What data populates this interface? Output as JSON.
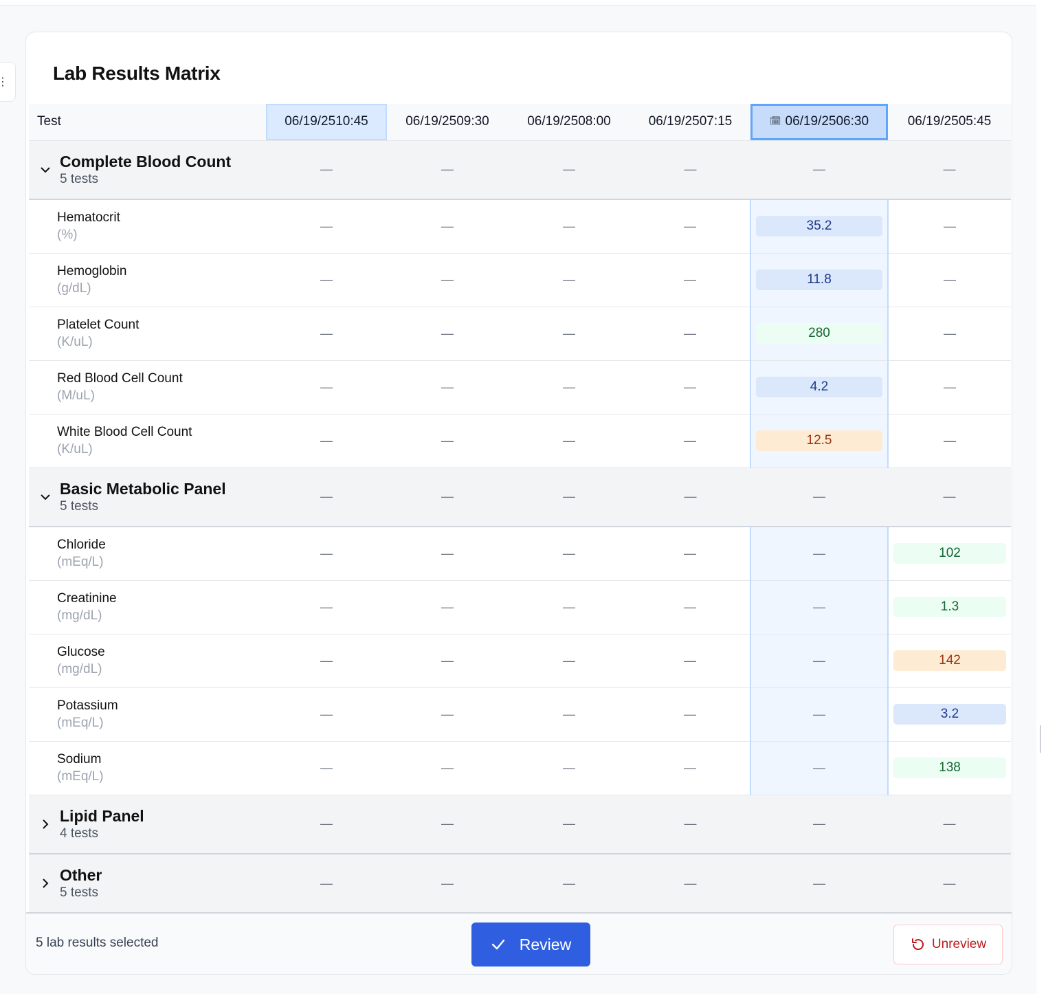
{
  "title": "Lab Results Matrix",
  "side_tab_glyph": "⋮",
  "columns": {
    "test": "Test",
    "times": [
      "06/19/2510:45",
      "06/19/2509:30",
      "06/19/2508:00",
      "06/19/2507:15",
      "06/19/2506:30",
      "06/19/2505:45"
    ],
    "calendar_icon": "🗓"
  },
  "empty": "—",
  "groups": [
    {
      "name": "Complete Blood Count",
      "count": "5 tests",
      "tests": [
        {
          "name": "Hematocrit",
          "unit": "(%)",
          "value": "35.2"
        },
        {
          "name": "Hemoglobin",
          "unit": "(g/dL)",
          "value": "11.8"
        },
        {
          "name": "Platelet Count",
          "unit": "(K/uL)",
          "value": "280"
        },
        {
          "name": "Red Blood Cell Count",
          "unit": "(M/uL)",
          "value": "4.2"
        },
        {
          "name": "White Blood Cell Count",
          "unit": "(K/uL)",
          "value": "12.5"
        }
      ]
    },
    {
      "name": "Basic Metabolic Panel",
      "count": "5 tests",
      "tests": [
        {
          "name": "Chloride",
          "unit": "(mEq/L)",
          "value": "102"
        },
        {
          "name": "Creatinine",
          "unit": "(mg/dL)",
          "value": "1.3"
        },
        {
          "name": "Glucose",
          "unit": "(mg/dL)",
          "value": "142"
        },
        {
          "name": "Potassium",
          "unit": "(mEq/L)",
          "value": "3.2"
        },
        {
          "name": "Sodium",
          "unit": "(mEq/L)",
          "value": "138"
        }
      ]
    },
    {
      "name": "Lipid Panel",
      "count": "4 tests"
    },
    {
      "name": "Other",
      "count": "5 tests"
    }
  ],
  "footer": {
    "selected_text": "5 lab results selected",
    "review_label": "Review",
    "unreview_label": "Unreview"
  },
  "colors": {
    "low": "#dbe7fb",
    "normal": "#ecfdf3",
    "high": "#fdebd3",
    "primary": "#2f5fe0",
    "danger": "#b91c1c"
  }
}
